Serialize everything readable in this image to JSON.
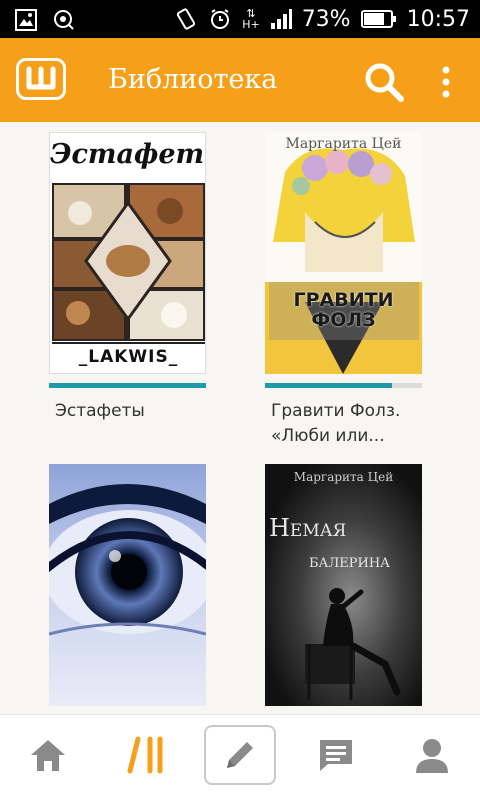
{
  "status_bar": {
    "battery": "73%",
    "time": "10:57",
    "network": "H+"
  },
  "app_bar": {
    "title": "Библиотека"
  },
  "books": [
    {
      "title": "Эстафеты",
      "cover_title": "Эстафеты",
      "cover_footer": "_LAKWIS_",
      "progress": 1.0
    },
    {
      "title": "Гравити Фолз. «Люби или...",
      "cover_author": "Маргарита Цей",
      "cover_title": "ГРАВИТИ ФОЛЗ",
      "progress": 0.81
    },
    {
      "title": "",
      "cover_art": "blue-eye"
    },
    {
      "title": "",
      "cover_author": "Маргарита Цей",
      "cover_title_1": "Немая",
      "cover_title_2": "балерина"
    }
  ],
  "bottom_nav": {
    "items": [
      "home-icon",
      "library-icon",
      "write-icon",
      "messages-icon",
      "profile-icon"
    ]
  },
  "colors": {
    "accent": "#f6a01a",
    "progress": "#1f9aa6",
    "active_nav": "#f6a01a",
    "inactive_nav": "#8a8a8a"
  }
}
